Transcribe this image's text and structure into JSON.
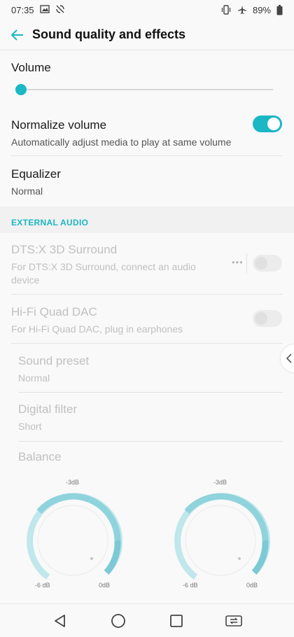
{
  "status_bar": {
    "time": "07:35",
    "battery": "89%",
    "icons": [
      "image-icon",
      "no-sync-icon",
      "vibrate-icon",
      "airplane-icon",
      "battery-icon"
    ]
  },
  "app_bar": {
    "title": "Sound quality and effects",
    "back_icon": "arrow-back-icon"
  },
  "volume": {
    "title": "Volume",
    "level": 0.02
  },
  "normalize": {
    "title": "Normalize volume",
    "subtitle": "Automatically adjust media to play at same volume",
    "enabled": true
  },
  "equalizer": {
    "title": "Equalizer",
    "value": "Normal"
  },
  "external_audio": {
    "header": "EXTERNAL AUDIO",
    "dts": {
      "title": "DTS:X 3D Surround",
      "subtitle": "For DTS:X 3D Surround, connect an audio device",
      "enabled": false
    },
    "dac": {
      "title": "Hi-Fi Quad DAC",
      "subtitle": "For Hi-Fi Quad DAC, plug in earphones",
      "enabled": false
    },
    "preset": {
      "title": "Sound preset",
      "value": "Normal"
    },
    "filter": {
      "title": "Digital filter",
      "value": "Short"
    },
    "balance": {
      "title": "Balance",
      "left": {
        "top_label": "-3dB",
        "min_label": "-6 dB",
        "max_label": "0dB"
      },
      "right": {
        "top_label": "-3dB",
        "min_label": "-6 dB",
        "max_label": "0dB"
      }
    }
  },
  "colors": {
    "accent": "#1ab7c5",
    "disabled_text": "#c0c0c0"
  },
  "nav": {
    "icons": [
      "back-triangle-icon",
      "home-circle-icon",
      "recents-square-icon",
      "screen-switch-icon"
    ]
  }
}
